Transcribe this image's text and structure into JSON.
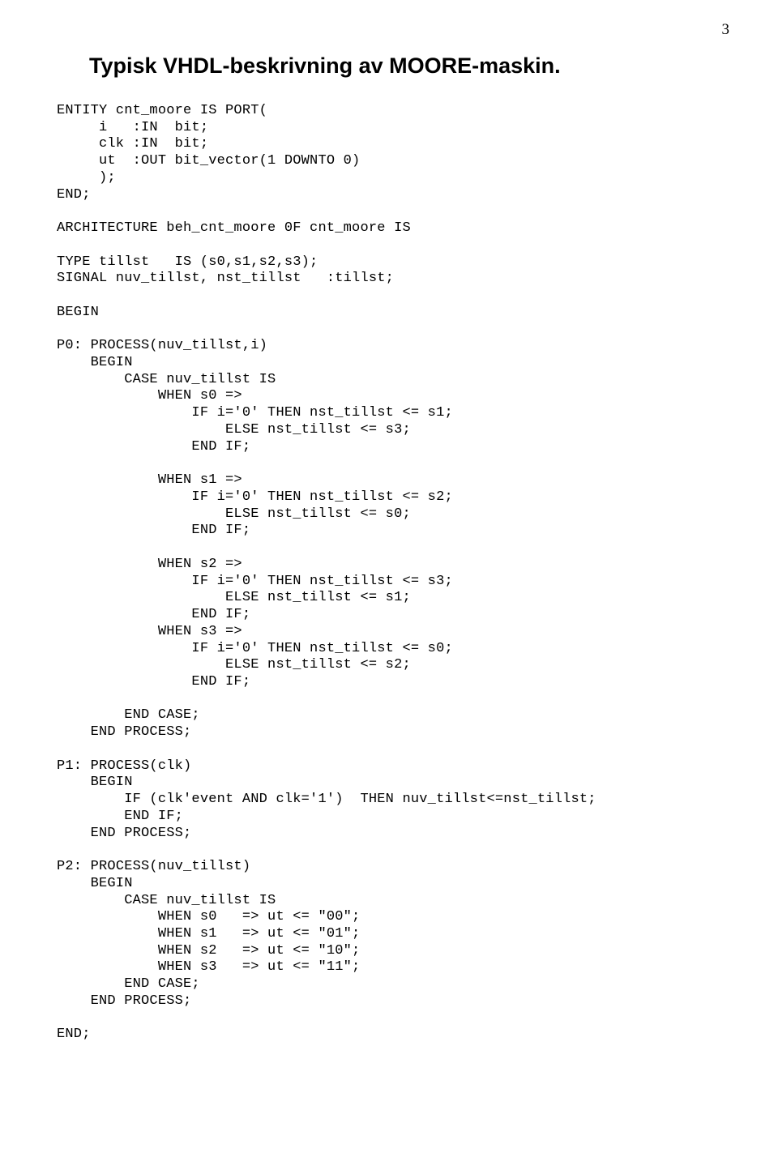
{
  "page_number": "3",
  "title": "Typisk VHDL-beskrivning av MOORE-maskin.",
  "code": "ENTITY cnt_moore IS PORT(\n     i   :IN  bit;\n     clk :IN  bit;\n     ut  :OUT bit_vector(1 DOWNTO 0)\n     );\nEND;\n\nARCHITECTURE beh_cnt_moore 0F cnt_moore IS\n\nTYPE tillst   IS (s0,s1,s2,s3);\nSIGNAL nuv_tillst, nst_tillst   :tillst;\n\nBEGIN\n\nP0: PROCESS(nuv_tillst,i)\n    BEGIN\n        CASE nuv_tillst IS\n            WHEN s0 =>\n                IF i='0' THEN nst_tillst <= s1;\n                    ELSE nst_tillst <= s3;\n                END IF;\n\n            WHEN s1 =>\n                IF i='0' THEN nst_tillst <= s2;\n                    ELSE nst_tillst <= s0;\n                END IF;\n\n            WHEN s2 =>\n                IF i='0' THEN nst_tillst <= s3;\n                    ELSE nst_tillst <= s1;\n                END IF;\n            WHEN s3 =>\n                IF i='0' THEN nst_tillst <= s0;\n                    ELSE nst_tillst <= s2;\n                END IF;\n\n        END CASE;\n    END PROCESS;\n\nP1: PROCESS(clk)\n    BEGIN\n        IF (clk'event AND clk='1')  THEN nuv_tillst<=nst_tillst;\n        END IF;\n    END PROCESS;\n\nP2: PROCESS(nuv_tillst)\n    BEGIN\n        CASE nuv_tillst IS\n            WHEN s0   => ut <= \"00\";\n            WHEN s1   => ut <= \"01\";\n            WHEN s2   => ut <= \"10\";\n            WHEN s3   => ut <= \"11\";\n        END CASE;\n    END PROCESS;\n\nEND;"
}
